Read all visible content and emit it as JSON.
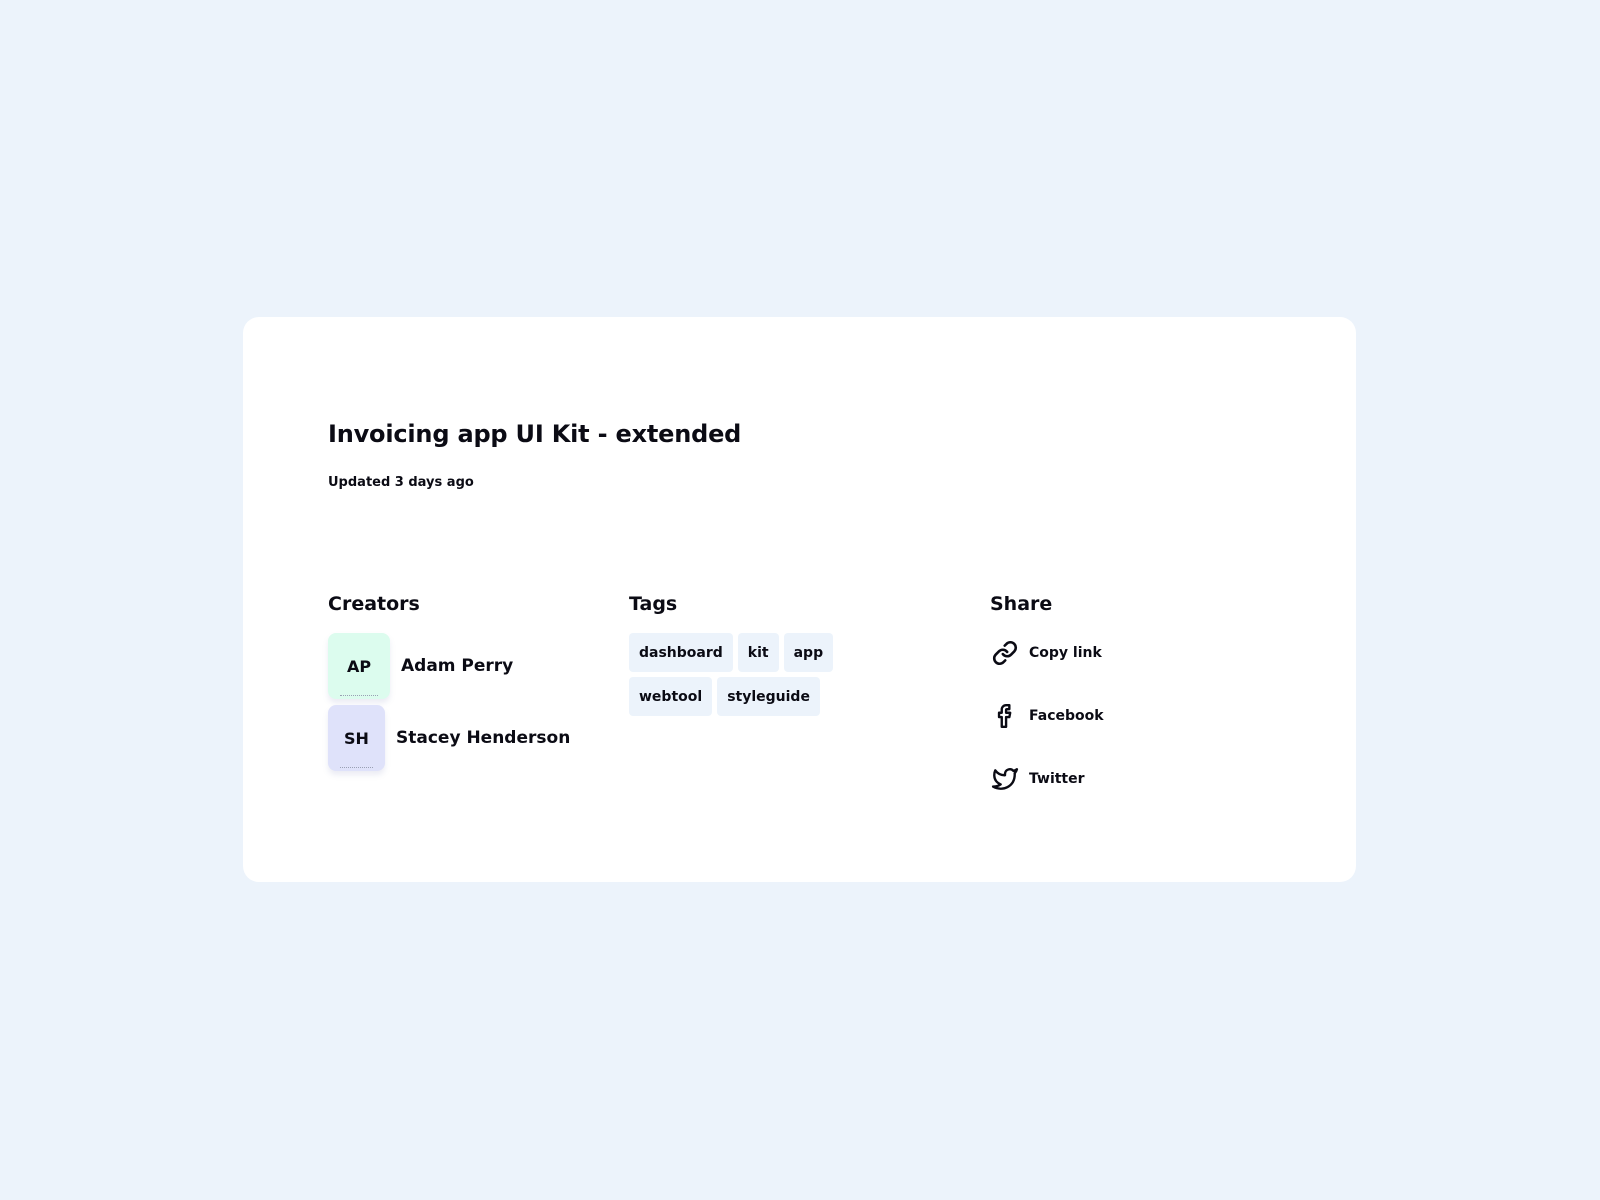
{
  "project": {
    "title": "Invoicing app UI Kit - extended",
    "updated": "Updated 3 days ago"
  },
  "creators": {
    "heading": "Creators",
    "items": [
      {
        "initials": "AP",
        "name": "Adam Perry",
        "color": "#dcfcee"
      },
      {
        "initials": "SH",
        "name": "Stacey Henderson",
        "color": "#dfe2fa"
      }
    ]
  },
  "tags": {
    "heading": "Tags",
    "items": [
      "dashboard",
      "kit",
      "app",
      "webtool",
      "styleguide"
    ],
    "background": "#ecf3fb"
  },
  "share": {
    "heading": "Share",
    "items": [
      {
        "label": "Copy link",
        "icon": "link-icon"
      },
      {
        "label": "Facebook",
        "icon": "facebook-icon"
      },
      {
        "label": "Twitter",
        "icon": "twitter-icon"
      }
    ]
  },
  "colors": {
    "page_background": "#ecf3fb",
    "card_background": "#ffffff",
    "text": "#0b0b14"
  }
}
